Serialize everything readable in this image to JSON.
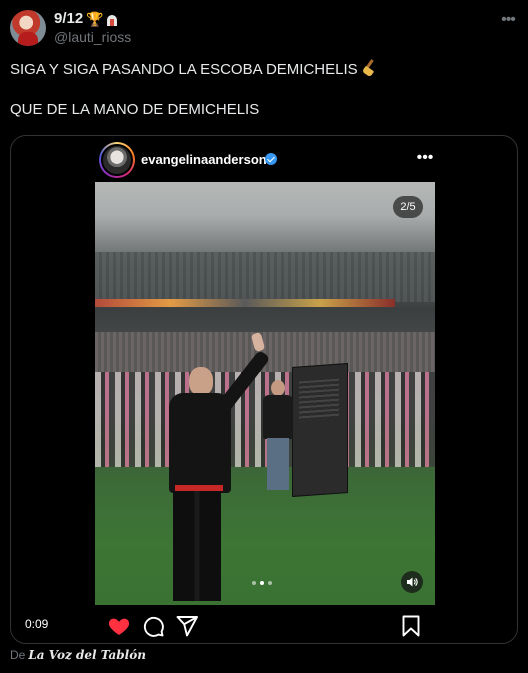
{
  "author": {
    "display_name": "9/12",
    "emoji_badges": [
      "trophy-icon",
      "castle-icon"
    ],
    "handle": "@lauti_rioss",
    "menu_icon": "more-horizontal-icon"
  },
  "tweet": {
    "line1": "SIGA Y SIGA PASANDO LA ESCOBA DEMICHELIS",
    "line1_emoji": "broom-icon",
    "line2": "QUE DE LA MANO DE DEMICHELIS"
  },
  "embed": {
    "username": "evangelinaanderson",
    "verified": true,
    "page_counter": "2/5",
    "carousel_total_dots": 3,
    "carousel_active_index": 1,
    "video_time": "0:09",
    "liked": true,
    "colors": {
      "like": "#ff3040",
      "verified": "#3897f0"
    }
  },
  "source": {
    "prefix": "De",
    "name": "La Voz del Tablón"
  }
}
